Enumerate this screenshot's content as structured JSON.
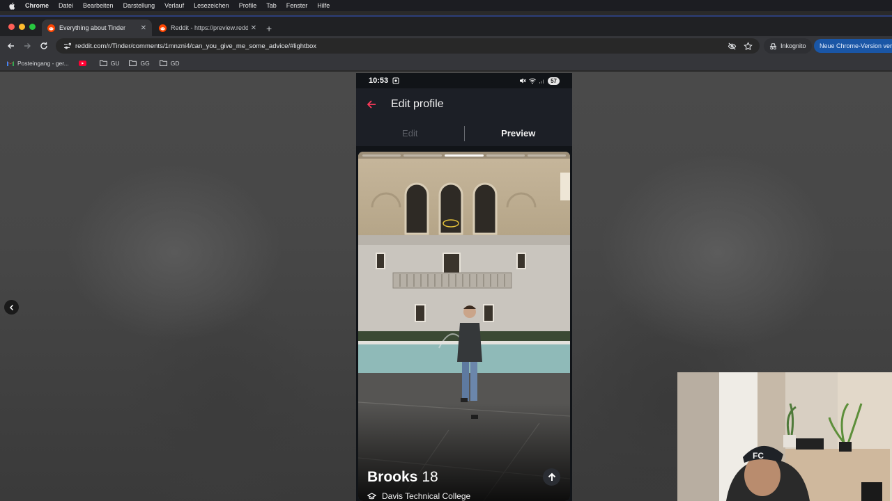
{
  "menubar": {
    "app": "Chrome",
    "items": [
      "Datei",
      "Bearbeiten",
      "Darstellung",
      "Verlauf",
      "Lesezeichen",
      "Profile",
      "Tab",
      "Fenster",
      "Hilfe"
    ]
  },
  "tabs": [
    {
      "title": "Everything about Tinder",
      "active": true
    },
    {
      "title": "Reddit - https://preview.redd",
      "active": false
    }
  ],
  "toolbar": {
    "url": "reddit.com/r/Tinder/comments/1mnzni4/can_you_give_me_some_advice/#lightbox",
    "incognito_label": "Inkognito",
    "update_label": "Neue Chrome-Version ver"
  },
  "bookmarks": [
    {
      "label": "Posteingang - ger...",
      "icon": "gmail-icon"
    },
    {
      "label": "",
      "icon": "youtube-icon"
    },
    {
      "label": "GU",
      "icon": "folder-icon"
    },
    {
      "label": "GG",
      "icon": "folder-icon"
    },
    {
      "label": "GD",
      "icon": "folder-icon"
    }
  ],
  "phone": {
    "time": "10:53",
    "battery": "57",
    "header_title": "Edit profile",
    "segments": {
      "edit": "Edit",
      "preview": "Preview"
    },
    "card": {
      "name": "Brooks",
      "age": "18",
      "school": "Davis Technical College",
      "photo_count": 5,
      "active_photo": 3
    }
  },
  "colors": {
    "tinder_accent": "#fd3a5a",
    "update_button": "#1a56a6",
    "tab_active": "#35363a"
  }
}
